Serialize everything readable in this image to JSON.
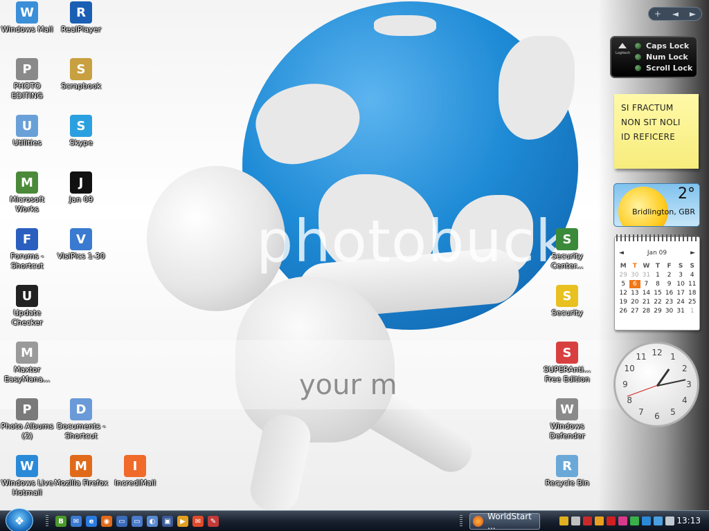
{
  "desktop": {
    "icons": [
      {
        "label": "Windows Mail",
        "icon": "windows-mail-icon",
        "color": "#3a8fd8"
      },
      {
        "label": "RealPlayer",
        "icon": "realplayer-icon",
        "color": "#1a5fb4"
      },
      {
        "label": "PHOTO EDITING",
        "icon": "camera-icon",
        "color": "#8a8a8a"
      },
      {
        "label": "Scrapbook",
        "icon": "scrapbook-icon",
        "color": "#c8a040"
      },
      {
        "label": "Utilities",
        "icon": "utilities-icon",
        "color": "#6aa0d8"
      },
      {
        "label": "Skype",
        "icon": "skype-icon",
        "color": "#2aa0e0"
      },
      {
        "label": "Microsoft Works",
        "icon": "microsoft-works-icon",
        "color": "#4a8a3a"
      },
      {
        "label": "Jan 09",
        "icon": "jan09-icon",
        "color": "#111111"
      },
      {
        "label": "Forums - Shortcut",
        "icon": "help-icon",
        "color": "#2a5fc0"
      },
      {
        "label": "VisiPics 1-30",
        "icon": "visipics-icon",
        "color": "#3a7ad0"
      },
      {
        "label": "Update Checker",
        "icon": "update-checker-icon",
        "color": "#222222"
      },
      {
        "label": "Maxtor EasyMana...",
        "icon": "maxtor-icon",
        "color": "#9a9a9a"
      },
      {
        "label": "Photo Albums (2)",
        "icon": "photo-albums-icon",
        "color": "#7a7a7a"
      },
      {
        "label": "Documents - Shortcut",
        "icon": "documents-icon",
        "color": "#6a9ad8"
      },
      {
        "label": "Windows Live Hotmail",
        "icon": "windows-live-hotmail-icon",
        "color": "#2a8ad8"
      },
      {
        "label": "Mozilla Firefox",
        "icon": "firefox-icon",
        "color": "#e06a1a"
      },
      {
        "label": "IncrediMail",
        "icon": "incredimail-icon",
        "color": "#f06a2a"
      },
      {
        "label": "Security Center...",
        "icon": "security-center-icon",
        "color": "#3a8a3a"
      },
      {
        "label": "Security",
        "icon": "security-shield-icon",
        "color": "#e8c020"
      },
      {
        "label": "SUPERAnti... Free Edition",
        "icon": "superantispyware-icon",
        "color": "#d84040"
      },
      {
        "label": "Windows Defender",
        "icon": "windows-defender-icon",
        "color": "#8a8a8a"
      },
      {
        "label": "Recycle Bin",
        "icon": "recycle-bin-icon",
        "color": "#6aa8d8"
      }
    ],
    "watermark": "photobuck",
    "watermark2": "your m"
  },
  "sidebar": {
    "controls": {
      "add": "+",
      "prev": "◄",
      "next": "►"
    },
    "locks": {
      "brand": "Logitech",
      "caps": "Caps Lock",
      "num": "Num Lock",
      "scroll": "Scroll Lock"
    },
    "note": {
      "lines": [
        "SI FRACTUM",
        "NON SIT NOLI",
        "ID REFICERE"
      ]
    },
    "weather": {
      "temp": "2°",
      "city": "Bridlington, GBR"
    },
    "calendar": {
      "month": "Jan 09",
      "weekdays": [
        "M",
        "T",
        "W",
        "T",
        "F",
        "S",
        "S"
      ],
      "days": [
        "29",
        "30",
        "31",
        "1",
        "2",
        "3",
        "4",
        "5",
        "6",
        "7",
        "8",
        "9",
        "10",
        "11",
        "12",
        "13",
        "14",
        "15",
        "16",
        "17",
        "18",
        "19",
        "20",
        "21",
        "22",
        "23",
        "24",
        "25",
        "26",
        "27",
        "28",
        "29",
        "30",
        "31",
        "1"
      ],
      "today": "6"
    },
    "clock": {
      "numbers": [
        "12",
        "1",
        "2",
        "3",
        "4",
        "5",
        "6",
        "7",
        "8",
        "9",
        "10",
        "11"
      ]
    }
  },
  "taskbar": {
    "start": "❖",
    "task_label": "WorldStart ...",
    "time": "13:13",
    "quicklaunch": [
      {
        "icon": "b-app-icon",
        "glyph": "B",
        "color": "#4a9a2a"
      },
      {
        "icon": "messenger-icon",
        "glyph": "✉",
        "color": "#3a7ad0"
      },
      {
        "icon": "internet-explorer-icon",
        "glyph": "e",
        "color": "#2a7ae0"
      },
      {
        "icon": "firefox-quicklaunch-icon",
        "glyph": "◉",
        "color": "#e06a1a"
      },
      {
        "icon": "folder-icon",
        "glyph": "▭",
        "color": "#3a6ab8"
      },
      {
        "icon": "show-desktop-icon",
        "glyph": "▭",
        "color": "#4a7ac8"
      },
      {
        "icon": "switch-windows-icon",
        "glyph": "◐",
        "color": "#5a8ad0"
      },
      {
        "icon": "network-icon",
        "glyph": "▣",
        "color": "#3a5a98"
      },
      {
        "icon": "media-player-icon",
        "glyph": "▶",
        "color": "#e0a020"
      },
      {
        "icon": "incredimail-quicklaunch-icon",
        "glyph": "✉",
        "color": "#e04a2a"
      },
      {
        "icon": "tool-icon",
        "glyph": "✎",
        "color": "#c03a3a"
      }
    ],
    "tray": [
      {
        "icon": "tray-app1-icon",
        "color": "#e0b020"
      },
      {
        "icon": "tray-app2-icon",
        "color": "#c0c0c0"
      },
      {
        "icon": "tray-app3-icon",
        "color": "#c82a2a"
      },
      {
        "icon": "tray-app4-icon",
        "color": "#e8a020"
      },
      {
        "icon": "tray-app5-icon",
        "color": "#d02020"
      },
      {
        "icon": "tray-app6-icon",
        "color": "#d83a8a"
      },
      {
        "icon": "tray-app7-icon",
        "color": "#3ab04a"
      },
      {
        "icon": "tray-app8-icon",
        "color": "#2a8ad8"
      },
      {
        "icon": "network-tray-icon",
        "color": "#4aa0e0"
      },
      {
        "icon": "volume-icon",
        "color": "#c0c8d0"
      }
    ]
  }
}
